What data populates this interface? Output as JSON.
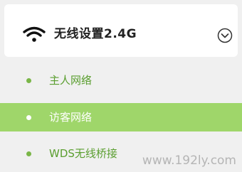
{
  "header": {
    "title": "无线设置2.4G",
    "icon": "wifi-icon",
    "toggle_icon": "chevron-down-circle-icon"
  },
  "menu": {
    "items": [
      {
        "label": "主人网络",
        "active": false
      },
      {
        "label": "访客网络",
        "active": true
      },
      {
        "label": "WDS无线桥接",
        "active": false
      }
    ]
  },
  "watermark": "www.192ly.com",
  "colors": {
    "accent": "#9fd66a",
    "text_green": "#5a9e2f",
    "dot_green": "#7ab648",
    "background": "#f0f0f0"
  }
}
